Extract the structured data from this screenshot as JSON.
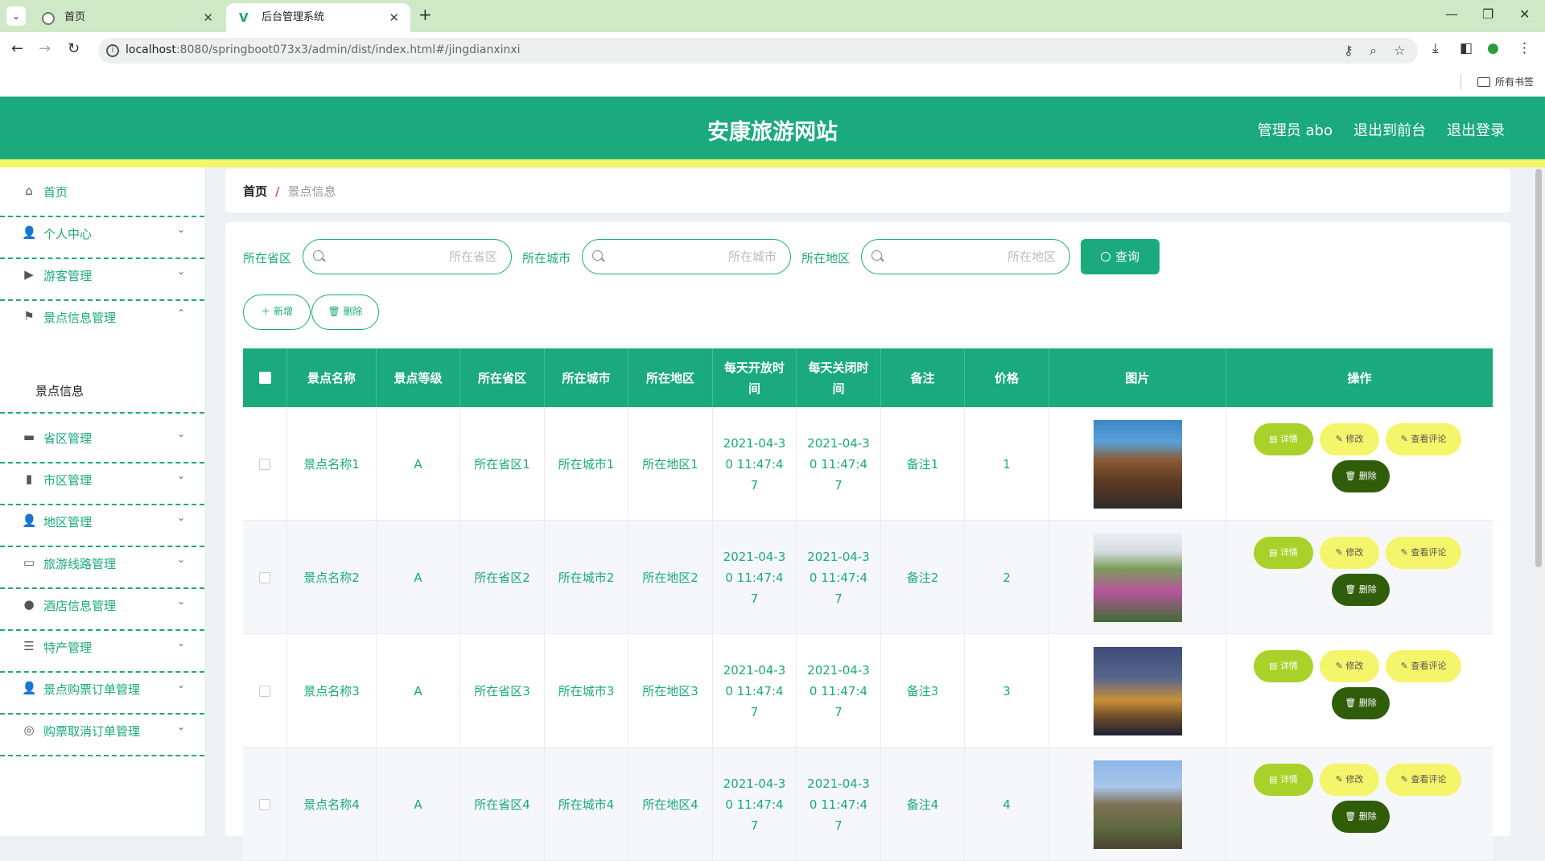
{
  "browser": {
    "tabs": [
      {
        "label": "首页"
      },
      {
        "label": "后台管理系统"
      }
    ],
    "url_host": "localhost",
    "url_path": ":8080/springboot073x3/admin/dist/index.html#/jingdianxinxi",
    "bookmarks_label": "所有书签"
  },
  "header": {
    "title": "安康旅游网站",
    "user": "管理员 abo",
    "to_front": "退出到前台",
    "logout": "退出登录"
  },
  "sidebar": {
    "items": [
      {
        "label": "首页",
        "icon": "home-icon"
      },
      {
        "label": "个人中心",
        "icon": "user-icon"
      },
      {
        "label": "游客管理",
        "icon": "video-icon"
      },
      {
        "label": "景点信息管理",
        "icon": "flag-icon"
      },
      {
        "label": "省区管理",
        "icon": "post-icon"
      },
      {
        "label": "市区管理",
        "icon": "chart-icon"
      },
      {
        "label": "地区管理",
        "icon": "user-icon"
      },
      {
        "label": "旅游线路管理",
        "icon": "chat-icon"
      },
      {
        "label": "酒店信息管理",
        "icon": "location-icon"
      },
      {
        "label": "特产管理",
        "icon": "sliders-icon"
      },
      {
        "label": "景点购票订单管理",
        "icon": "user-icon"
      },
      {
        "label": "购票取消订单管理",
        "icon": "basketball-icon"
      }
    ],
    "sub_active": "景点信息"
  },
  "breadcrumb": {
    "home": "首页",
    "current": "景点信息"
  },
  "filters": {
    "province_label": "所在省区",
    "province_placeholder": "所在省区",
    "city_label": "所在城市",
    "city_placeholder": "所在城市",
    "area_label": "所在地区",
    "area_placeholder": "所在地区",
    "query_label": "查询"
  },
  "actions": {
    "add_label": "新增",
    "delete_label": "删除"
  },
  "table": {
    "headers": {
      "name": "景点名称",
      "level": "景点等级",
      "province": "所在省区",
      "city": "所在城市",
      "area": "所在地区",
      "open_time": "每天开放时间",
      "close_time": "每天关闭时间",
      "note": "备注",
      "price": "价格",
      "image": "图片",
      "ops": "操作"
    },
    "rows": [
      {
        "name": "景点名称1",
        "level": "A",
        "province": "所在省区1",
        "city": "所在城市1",
        "area": "所在地区1",
        "open_time": "2021-04-30 11:47:47",
        "close_time": "2021-04-30 11:47:47",
        "note": "备注1",
        "price": "1"
      },
      {
        "name": "景点名称2",
        "level": "A",
        "province": "所在省区2",
        "city": "所在城市2",
        "area": "所在地区2",
        "open_time": "2021-04-30 11:47:47",
        "close_time": "2021-04-30 11:47:47",
        "note": "备注2",
        "price": "2"
      },
      {
        "name": "景点名称3",
        "level": "A",
        "province": "所在省区3",
        "city": "所在城市3",
        "area": "所在地区3",
        "open_time": "2021-04-30 11:47:47",
        "close_time": "2021-04-30 11:47:47",
        "note": "备注3",
        "price": "3"
      },
      {
        "name": "景点名称4",
        "level": "A",
        "province": "所在省区4",
        "city": "所在城市4",
        "area": "所在地区4",
        "open_time": "2021-04-30 11:47:47",
        "close_time": "2021-04-30 11:47:47",
        "note": "备注4",
        "price": "4"
      }
    ],
    "op_labels": {
      "detail": "详情",
      "edit": "修改",
      "comment": "查看评论",
      "delete": "删除"
    }
  },
  "colors": {
    "primary": "#1aaa7c",
    "accent_yellow": "#f4f56a",
    "detail_green": "#a8d12a",
    "delete_dark": "#2f5d09"
  }
}
